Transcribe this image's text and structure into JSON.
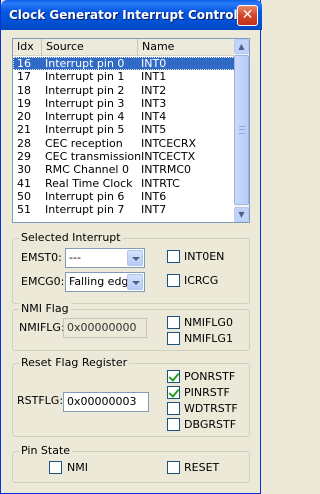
{
  "window": {
    "title": "Clock Generator Interrupt Control",
    "close_glyph": "✕"
  },
  "list": {
    "columns": [
      "Idx",
      "Source",
      "Name"
    ],
    "rows": [
      [
        "16",
        "Interrupt pin 0",
        "INT0"
      ],
      [
        "17",
        "Interrupt pin 1",
        "INT1"
      ],
      [
        "18",
        "Interrupt pin 2",
        "INT2"
      ],
      [
        "19",
        "Interrupt pin 3",
        "INT3"
      ],
      [
        "20",
        "Interrupt pin 4",
        "INT4"
      ],
      [
        "21",
        "Interrupt pin 5",
        "INT5"
      ],
      [
        "28",
        "CEC reception",
        "INTCECRX"
      ],
      [
        "29",
        "CEC transmission",
        "INTCECTX"
      ],
      [
        "30",
        "RMC Channel 0",
        "INTRMC0"
      ],
      [
        "41",
        "Real Time Clock",
        "INTRTC"
      ],
      [
        "50",
        "Interrupt pin 6",
        "INT6"
      ],
      [
        "51",
        "Interrupt pin 7",
        "INT7"
      ]
    ],
    "selected_index": 0
  },
  "selected_interrupt": {
    "legend": "Selected Interrupt",
    "emst0_label": "EMST0:",
    "emst0_value": "---",
    "emcg0_label": "EMCG0:",
    "emcg0_value": "Falling edge",
    "int0en_label": "INT0EN",
    "int0en_checked": false,
    "icrcg_label": "ICRCG",
    "icrcg_checked": false
  },
  "nmi_flag": {
    "legend": "NMI Flag",
    "nmiflg_label": "NMIFLG:",
    "nmiflg_value": "0x00000000",
    "nmiflg0_label": "NMIFLG0",
    "nmiflg0_checked": false,
    "nmiflg1_label": "NMIFLG1",
    "nmiflg1_checked": false
  },
  "reset_flag": {
    "legend": "Reset Flag Register",
    "rstflg_label": "RSTFLG:",
    "rstflg_value": "0x00000003",
    "ponrstf_label": "PONRSTF",
    "ponrstf_checked": true,
    "pinrstf_label": "PINRSTF",
    "pinrstf_checked": true,
    "wdtrstf_label": "WDTRSTF",
    "wdtrstf_checked": false,
    "dbgrstf_label": "DBGRSTF",
    "dbgrstf_checked": false
  },
  "pin_state": {
    "legend": "Pin State",
    "nmi_label": "NMI",
    "nmi_checked": false,
    "reset_label": "RESET",
    "reset_checked": false
  }
}
